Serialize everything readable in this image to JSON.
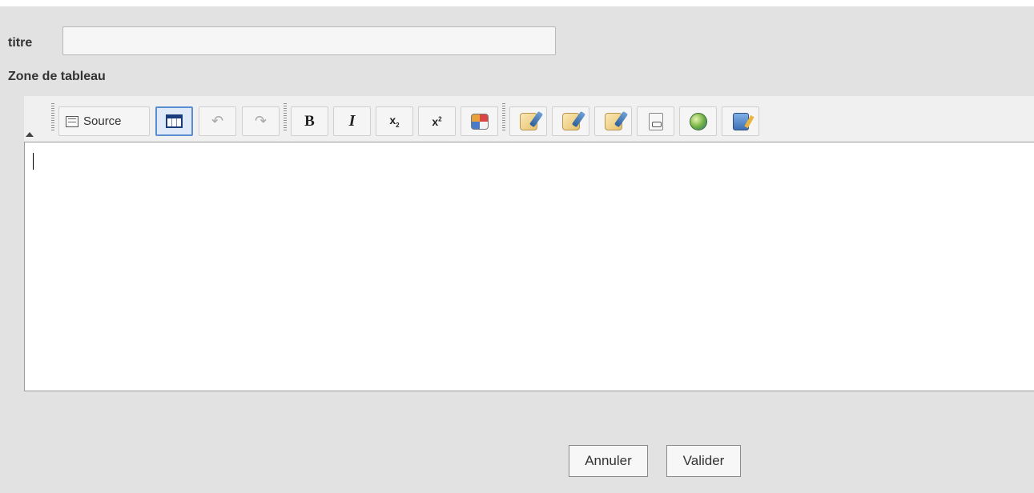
{
  "form": {
    "title_label": "titre",
    "title_value": "",
    "zone_label": "Zone de tableau"
  },
  "toolbar": {
    "source_label": "Source",
    "items": [
      "source-button",
      "table-button",
      "undo-button",
      "redo-button",
      "bold-button",
      "italic-button",
      "subscript-button",
      "superscript-button",
      "special-char-button",
      "math-formula-button",
      "square-root-button",
      "edit-pencil-button",
      "insert-link-button",
      "globe-button",
      "notes-button"
    ]
  },
  "editor": {
    "content": ""
  },
  "actions": {
    "cancel_label": "Annuler",
    "ok_label": "Valider"
  },
  "colors": {
    "background": "#e2e2e2",
    "active_button_border": "#5a8ed0"
  }
}
